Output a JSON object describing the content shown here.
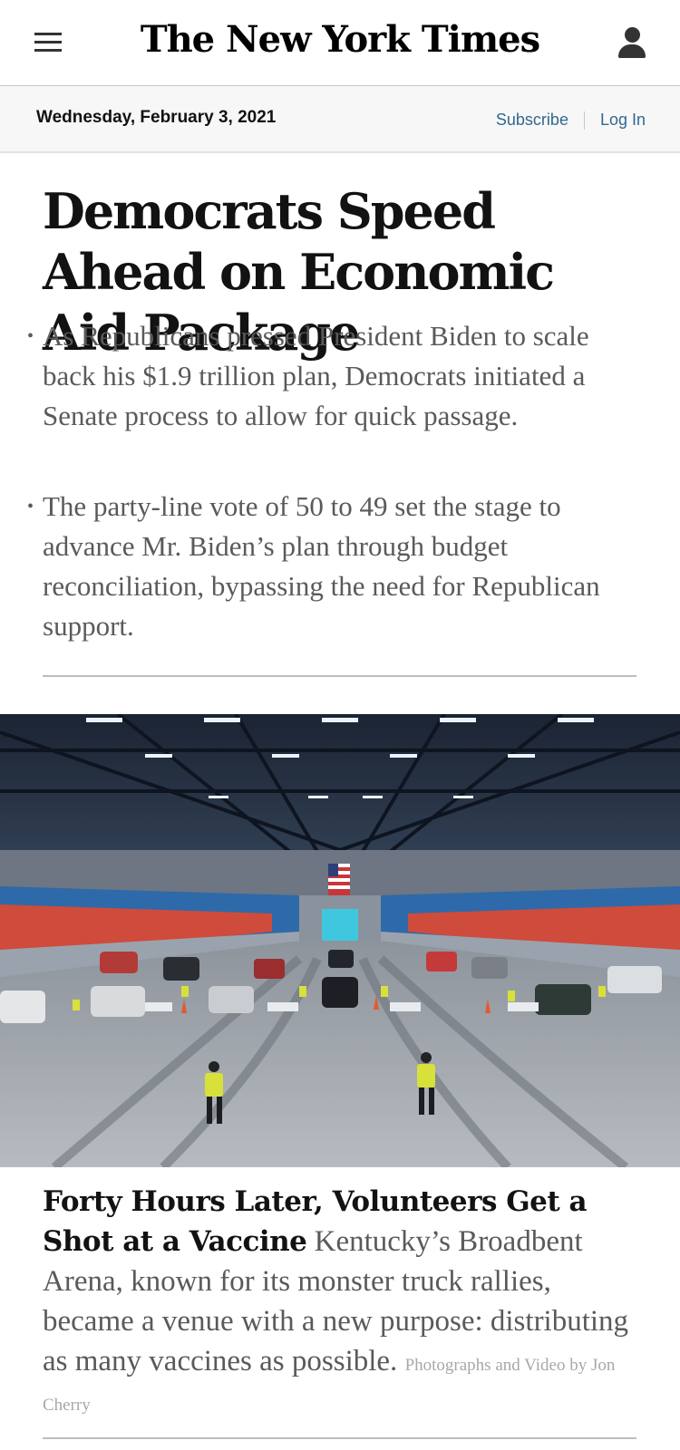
{
  "header": {
    "logo_text": "The New York Times",
    "menu_icon": "hamburger-menu-icon",
    "user_icon": "user-account-icon"
  },
  "datebar": {
    "date": "Wednesday, February 3, 2021",
    "subscribe": "Subscribe",
    "login": "Log In"
  },
  "lead_story": {
    "headline": "Democrats Speed Ahead on Economic Aid Package",
    "bullets": [
      "As Republicans pressed President Biden to scale back his $1.9 trillion plan, Democrats initiated a Senate process to allow for quick passage.",
      "The party-line vote of 50 to 49 set the stage to advance Mr. Biden’s plan through budget reconciliation, bypassing the need for Republican support."
    ]
  },
  "second_story": {
    "headline": "Forty Hours Later, Volunteers Get a Shot at a Vaccine",
    "summary": "Kentucky’s Broadbent Arena, known for its monster truck rallies, became a venue with a new purpose: distributing as many vaccines as possible.",
    "credit": "Photographs and Video by Jon Cherry"
  },
  "colors": {
    "link": "#326891",
    "summary_text": "#5a5a5a",
    "credit_text": "#a8a8a8",
    "datebar_bg": "#f7f7f7"
  }
}
